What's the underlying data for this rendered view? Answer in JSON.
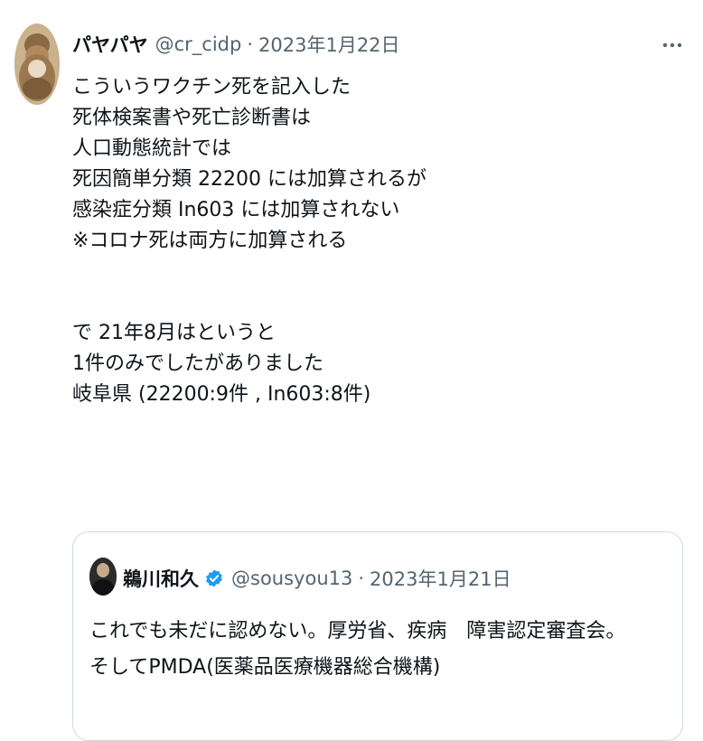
{
  "tweet": {
    "display_name": "パヤパヤ",
    "handle": "@cr_cidp",
    "separator": "·",
    "date": "2023年1月22日",
    "more_icon": "more-horizontal-icon",
    "lines": [
      "こういうワクチン死を記入した",
      "死体検案書や死亡診断書は",
      "人口動態統計では",
      "死因簡単分類 22200 には加算されるが",
      "感染症分類 In603 には加算されない",
      "※コロナ死は両方に加算される",
      "で 21年8月はというと",
      "1件のみでしたがありました",
      "岐阜県 (22200:9件 , In603:8件)"
    ]
  },
  "quote": {
    "display_name": "鵜川和久",
    "verified_icon": "verified-badge-icon",
    "handle": "@sousyou13",
    "separator": "·",
    "date": "2023年1月21日",
    "lines": [
      "これでも未だに認めない。厚労省、疾病　障害認定審査会。",
      "そしてPMDA(医薬品医療機器総合機構)"
    ]
  },
  "colors": {
    "text": "#0f1419",
    "secondary": "#536471",
    "border": "#cfd9de",
    "verified": "#1d9bf0"
  }
}
